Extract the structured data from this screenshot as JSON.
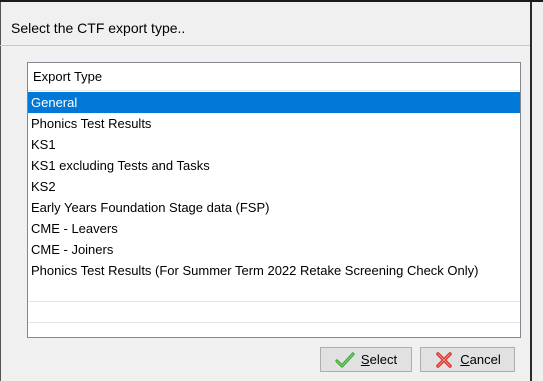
{
  "dialog": {
    "prompt": "Select the CTF export type.."
  },
  "list": {
    "header": "Export Type",
    "selected_index": 0,
    "items": [
      "General",
      "Phonics Test Results",
      "KS1",
      "KS1 excluding Tests and Tasks",
      "KS2",
      "Early Years Foundation Stage data (FSP)",
      "CME - Leavers",
      "CME - Joiners",
      "Phonics Test Results (For Summer Term 2022 Retake Screening Check Only)"
    ]
  },
  "buttons": {
    "select": {
      "mnemonic": "S",
      "rest": "elect",
      "icon": "green-checkmark-icon"
    },
    "cancel": {
      "mnemonic": "C",
      "rest": "ancel",
      "icon": "red-x-icon"
    }
  },
  "colors": {
    "selection": "#0078d7",
    "check": "#3ea83a",
    "cross": "#d9382f"
  }
}
